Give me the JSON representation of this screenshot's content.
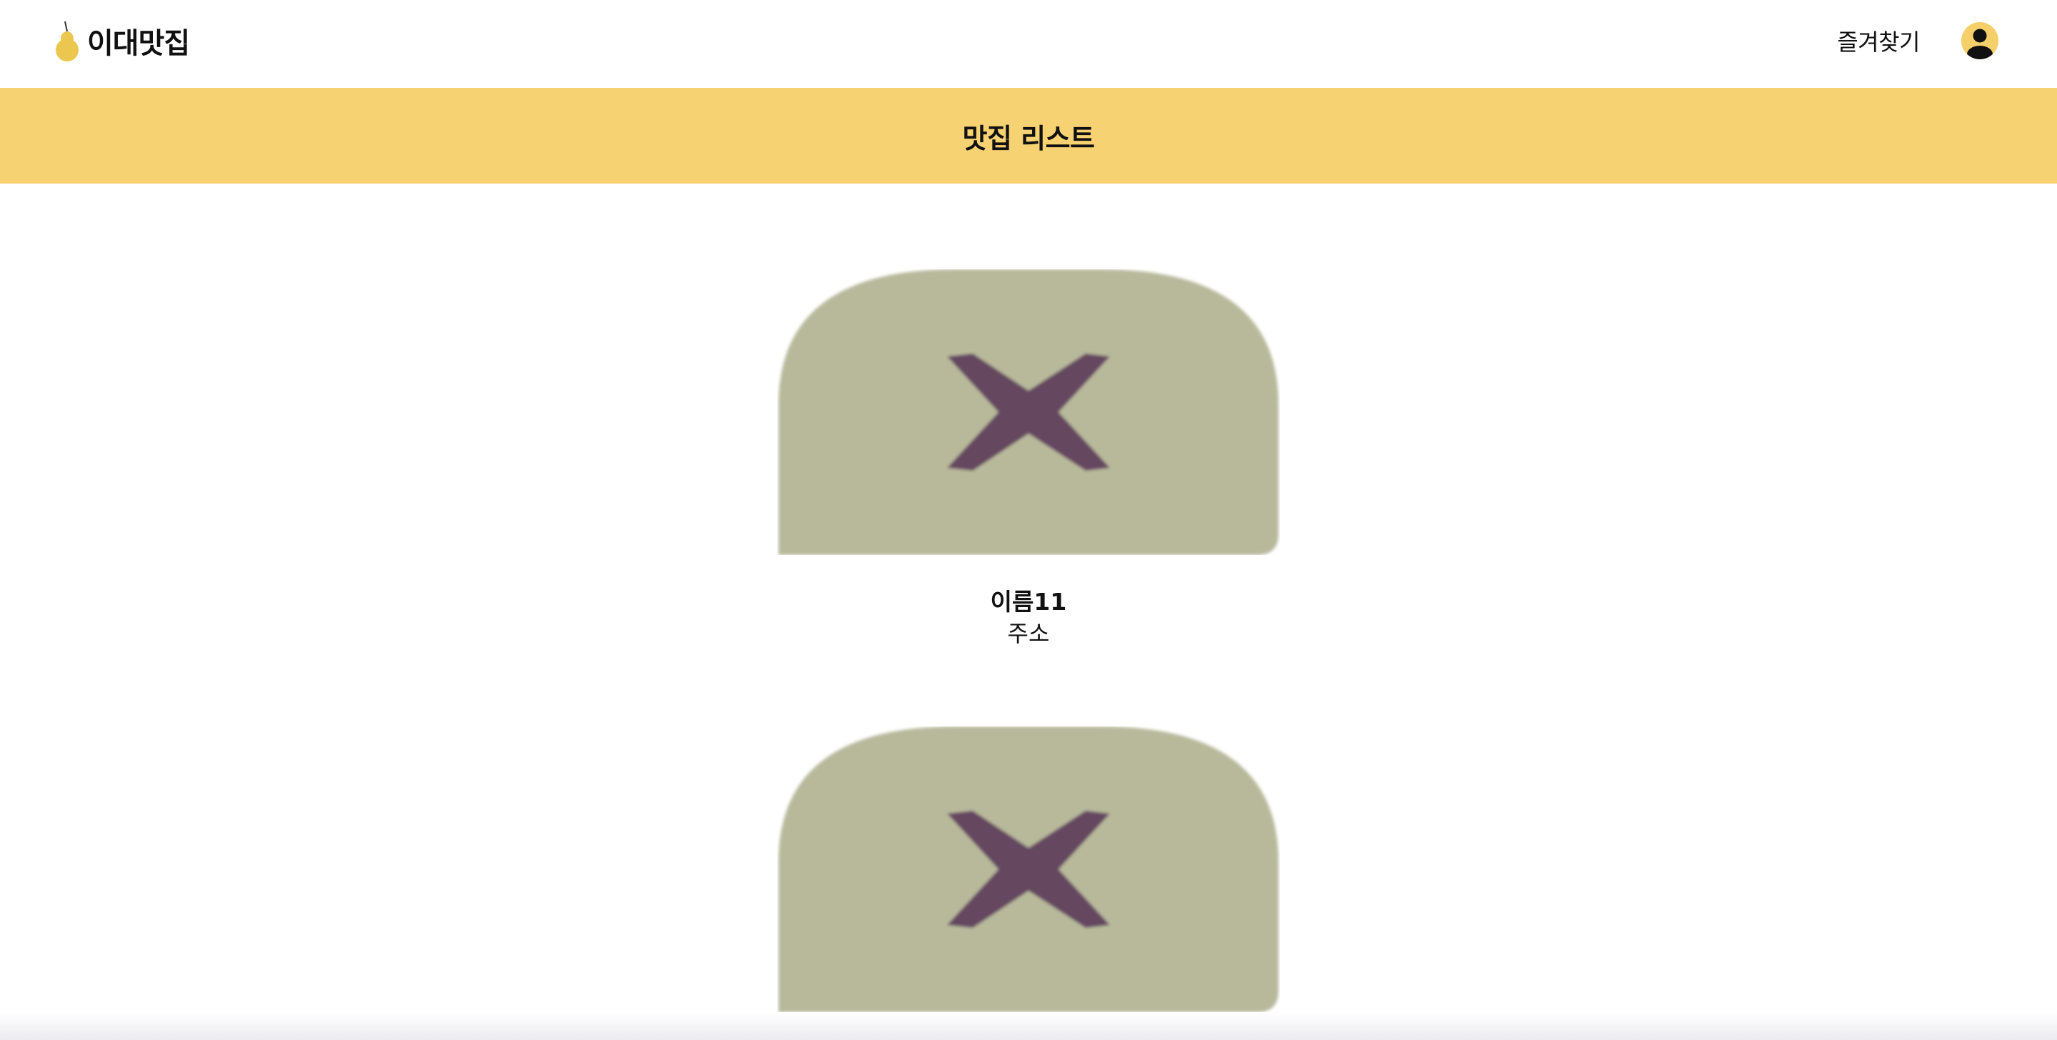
{
  "header": {
    "brand_name": "이대맛집",
    "favorites_label": "즐겨찾기"
  },
  "banner": {
    "title": "맛집 리스트"
  },
  "restaurants": [
    {
      "name": "이름11",
      "address": "주소"
    },
    {
      "name": "",
      "address": ""
    }
  ],
  "colors": {
    "brand_yellow": "#f7d273",
    "logo_pear": "#ecc74f",
    "placeholder_bg": "#b8b99b",
    "placeholder_x": "#654761"
  },
  "icons": {
    "logo": "pear-icon",
    "profile": "user-avatar-icon",
    "image_placeholder": "broken-image-icon"
  }
}
